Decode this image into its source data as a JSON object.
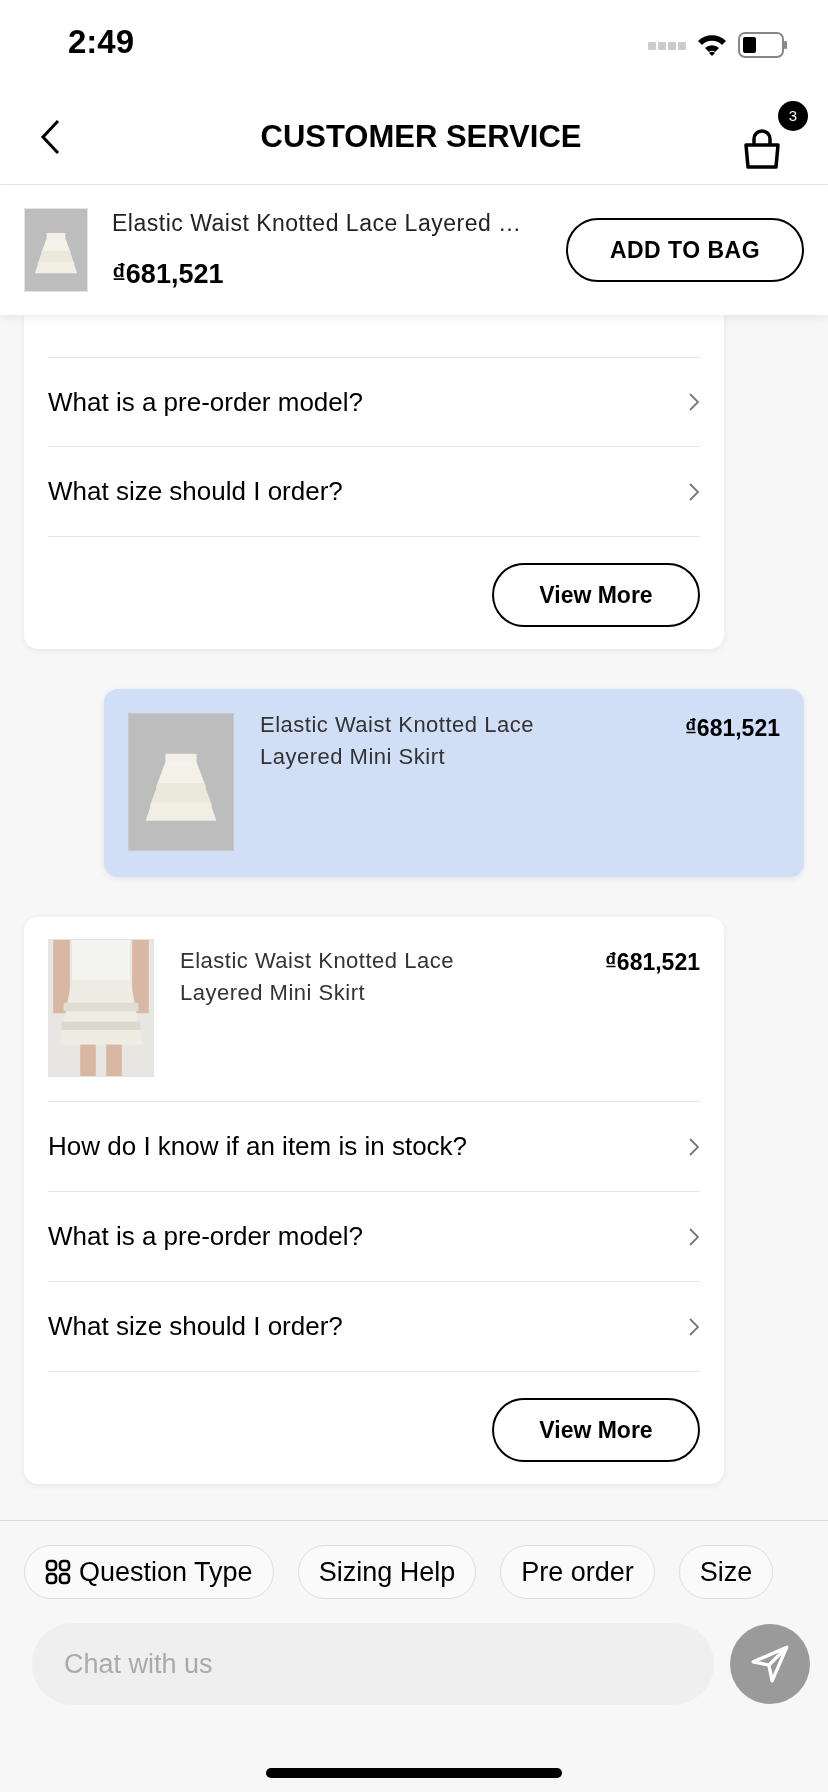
{
  "status_bar": {
    "time": "2:49"
  },
  "header": {
    "title": "CUSTOMER SERVICE",
    "cart_count": "3"
  },
  "product_bar": {
    "name": "Elastic Waist Knotted Lace Layered …",
    "price": "₫681,521",
    "button": "ADD TO BAG"
  },
  "messages": [
    {
      "kind": "faq_card",
      "questions": [
        "What is a pre-order model?",
        "What size should I order?"
      ],
      "button": "View More"
    },
    {
      "kind": "product_bubble",
      "name": "Elastic Waist Knotted Lace Layered Mini Skirt",
      "price": "₫681,521"
    },
    {
      "kind": "faq_card",
      "product": {
        "name": "Elastic Waist Knotted Lace Layered Mini Skirt",
        "price": "₫681,521"
      },
      "questions": [
        "How do I know if an item is in stock?",
        "What is a pre-order model?",
        "What size should I order?"
      ],
      "button": "View More"
    }
  ],
  "quick_replies": [
    {
      "label": "Question Type",
      "kind": "menu"
    },
    {
      "label": "Sizing Help",
      "kind": "plain"
    },
    {
      "label": "Pre order",
      "kind": "plain"
    },
    {
      "label": "Size",
      "kind": "plain"
    }
  ],
  "chat_input": {
    "placeholder": "Chat with us"
  }
}
